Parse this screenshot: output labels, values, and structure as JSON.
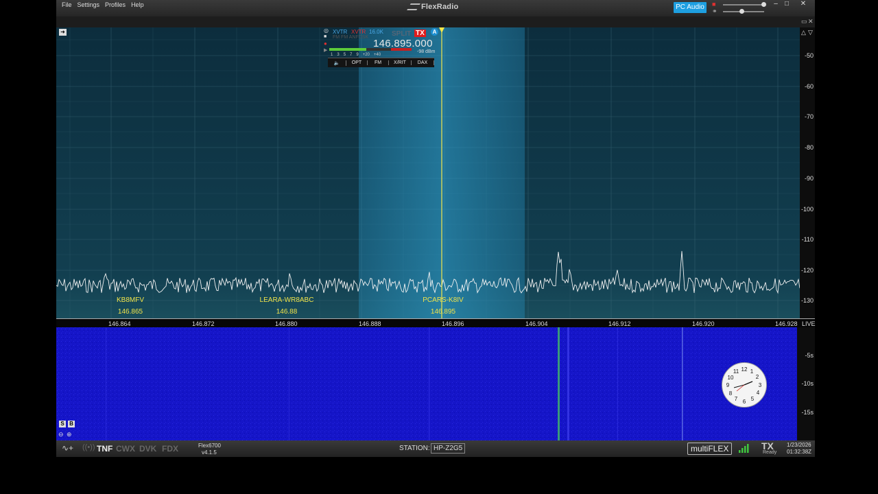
{
  "menu": {
    "items": [
      "File",
      "Settings",
      "Profiles",
      "Help"
    ]
  },
  "titlebar": {
    "brand": "FlexRadio",
    "pc_audio": "PC Audio",
    "minimize": "–",
    "maximize": "□",
    "close": "✕"
  },
  "panadapter": {
    "db_ticks": [
      "-50",
      "-60",
      "-70",
      "-80",
      "-90",
      "-100",
      "-110",
      "-120",
      "-130"
    ],
    "freq_ticks": [
      "146.864",
      "146.872",
      "146.880",
      "146.888",
      "146.896",
      "146.904",
      "146.912",
      "146.920",
      "146.928"
    ],
    "live_label": "LIVE",
    "spots": [
      {
        "callsign": "KB8MFV",
        "freq": "146.865"
      },
      {
        "callsign": "LEARA-WR8ABC",
        "freq": "146.88"
      },
      {
        "callsign": "PCARS-K8IV",
        "freq": "146.895"
      }
    ]
  },
  "slice": {
    "xvtr1": "XVTR",
    "xvtr2": "XVTR",
    "bandwidth": "16.0K",
    "split": "SPLIT",
    "tx": "TX",
    "letter": "A",
    "frequency": "146.895.000",
    "signal": "-98 dBm",
    "meter_scale": [
      "1",
      "3",
      "5",
      "7",
      "9",
      "+20",
      "+40"
    ],
    "meter_level": 0.45,
    "tabs": [
      "OPT",
      "FM",
      "X/RIT",
      "DAX"
    ],
    "overlay_text": "FM FM ANFDSK"
  },
  "waterfall": {
    "time_ticks": [
      "-5s",
      "-10s",
      "-15s"
    ],
    "buttons": {
      "s": "S",
      "b": "B"
    }
  },
  "clock": {
    "numbers": [
      "12",
      "1",
      "2",
      "3",
      "4",
      "5",
      "6",
      "7",
      "8",
      "9",
      "10",
      "11"
    ]
  },
  "statusbar": {
    "tnf": "TNF",
    "cwx": "CWX",
    "dvk": "DVK",
    "fdx": "FDX",
    "radio_model": "Flex6700",
    "radio_version": "v4.1.5",
    "station_label": "STATION:",
    "station_name": "HP-Z2G5",
    "multiflex": "multiFLEX",
    "tx": "TX",
    "tx_state": "Ready",
    "date": "1/23/2026",
    "time": "01:32:38Z"
  },
  "colors": {
    "accent": "#1e9fe0",
    "spot": "#f0e34a",
    "tx_red": "#e01c1c",
    "waterfall": "#1515c8"
  }
}
